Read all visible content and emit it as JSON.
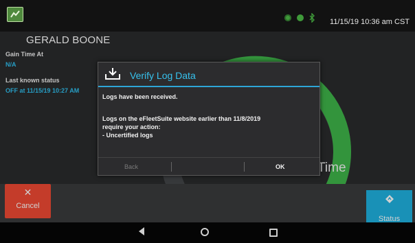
{
  "status_bar": {
    "datetime": "11/15/19 10:36 am CST",
    "icons": [
      "app-logo-icon",
      "gps-icon",
      "cellular-icon",
      "bluetooth-icon"
    ]
  },
  "driver": {
    "name": "GERALD BOONE"
  },
  "info": [
    {
      "label": "Gain Time At",
      "value": "N/A"
    },
    {
      "label": "Last known status",
      "value": "OFF at 11/15/19 10:27 AM"
    }
  ],
  "gauge": {
    "label_visible": "Time"
  },
  "buttons": {
    "cancel": {
      "label": "Cancel",
      "icon": "close-icon"
    },
    "status": {
      "label": "Status",
      "icon": "status-icon"
    }
  },
  "dialog": {
    "title": "Verify Log Data",
    "icon": "download-icon",
    "lines": [
      "Logs have been received.",
      "Logs on the eFleetSuite website earlier than 11/8/2019",
      "require your action:",
      "- Uncertified logs"
    ],
    "back_label": "Back",
    "ok_label": "OK"
  },
  "colors": {
    "accent": "#2ea6d8",
    "cancel": "#f04a34",
    "status": "#1fb1e0",
    "gauge": "#3fb54a"
  }
}
